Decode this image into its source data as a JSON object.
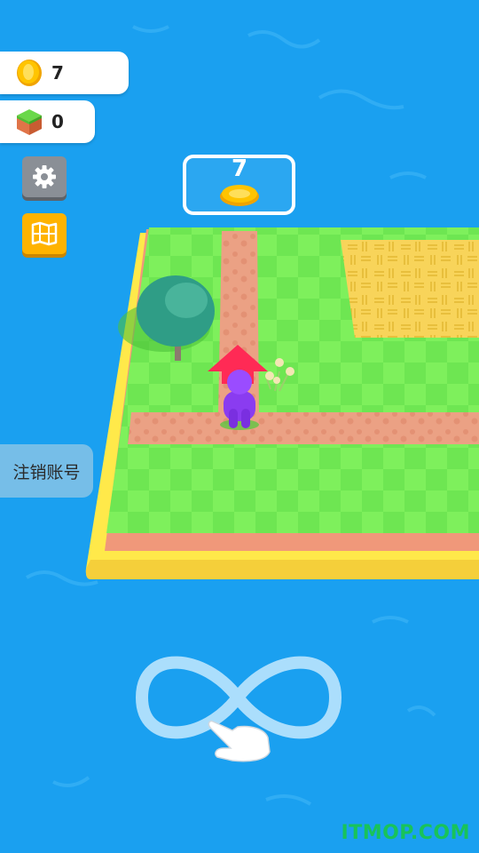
{
  "hud": {
    "coins": "7",
    "cubes": "0"
  },
  "unlock_zone": {
    "cost": "7",
    "icon": "coin-icon"
  },
  "buttons": {
    "settings_icon": "gear-icon",
    "map_icon": "map-icon",
    "cancel_account": "注销账号"
  },
  "tutorial": {
    "gesture": "infinity-swipe",
    "icon": "hand-pointer-icon"
  },
  "watermark": "ITMOP.COM",
  "colors": {
    "water": "#1aa0f0",
    "grass_light": "#7ef05c",
    "grass_dark": "#5fdc45",
    "path": "#e89a7c",
    "island_rim": "#ffe94a",
    "player": "#8a3cf0",
    "arrow": "#ff2a55",
    "coin": "#ffc400",
    "watermark": "#18c35a"
  }
}
